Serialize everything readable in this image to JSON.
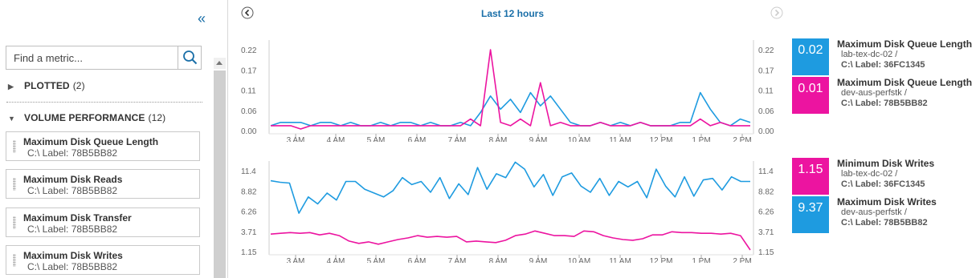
{
  "colors": {
    "blue": "#1e9be0",
    "magenta": "#ec14a0",
    "accent": "#1a6fa8"
  },
  "sidebar": {
    "collapse_icon": "double-chevron-left-icon",
    "search": {
      "placeholder": "Find a metric...",
      "value": ""
    },
    "groups": [
      {
        "label": "PLOTTED",
        "count": "(2)",
        "expanded": false
      },
      {
        "label": "VOLUME PERFORMANCE",
        "count": "(12)",
        "expanded": true
      }
    ],
    "metrics": [
      {
        "name": "Maximum Disk Queue Length",
        "label": "C:\\ Label: 78B5BB82"
      },
      {
        "name": "Maximum Disk Reads",
        "label": "C:\\ Label: 78B5BB82"
      },
      {
        "name": "Maximum Disk Transfer",
        "label": "C:\\ Label: 78B5BB82"
      },
      {
        "name": "Maximum Disk Writes",
        "label": "C:\\ Label: 78B5BB82"
      }
    ]
  },
  "header": {
    "time_range": "Last 12 hours"
  },
  "chart_data": [
    {
      "type": "line",
      "title": "",
      "x": [
        "2:30 AM",
        "2:45 AM",
        "3 AM",
        "3:15 AM",
        "3:30 AM",
        "3:45 AM",
        "4 AM",
        "4:15 AM",
        "4:30 AM",
        "4:45 AM",
        "5 AM",
        "5:15 AM",
        "5:30 AM",
        "5:45 AM",
        "6 AM",
        "6:15 AM",
        "6:30 AM",
        "6:45 AM",
        "7 AM",
        "7:15 AM",
        "7:30 AM",
        "7:45 AM",
        "8 AM",
        "8:15 AM",
        "8:30 AM",
        "8:45 AM",
        "9 AM",
        "9:15 AM",
        "9:30 AM",
        "9:45 AM",
        "10 AM",
        "10:15 AM",
        "10:30 AM",
        "10:45 AM",
        "11 AM",
        "11:15 AM",
        "11:30 AM",
        "11:45 AM",
        "12 PM",
        "12:15 PM",
        "12:30 PM",
        "12:45 PM",
        "1 PM",
        "1:15 PM",
        "1:30 PM",
        "1:45 PM",
        "2 PM",
        "2:15 PM"
      ],
      "xticks": [
        "3 AM",
        "4 AM",
        "5 AM",
        "6 AM",
        "7 AM",
        "8 AM",
        "9 AM",
        "10 AM",
        "11 AM",
        "12 PM",
        "1 PM",
        "2 PM"
      ],
      "yticks": [
        "0.22",
        "0.17",
        "0.11",
        "0.06",
        "0.00"
      ],
      "ylim": [
        0,
        0.24
      ],
      "series": [
        {
          "name": "lab-tex-dc-02",
          "color": "#1e9be0",
          "values": [
            0.01,
            0.02,
            0.02,
            0.02,
            0.01,
            0.02,
            0.02,
            0.01,
            0.02,
            0.01,
            0.01,
            0.02,
            0.01,
            0.02,
            0.02,
            0.01,
            0.02,
            0.01,
            0.01,
            0.02,
            0.01,
            0.05,
            0.1,
            0.06,
            0.09,
            0.05,
            0.11,
            0.07,
            0.1,
            0.06,
            0.02,
            0.01,
            0.01,
            0.02,
            0.01,
            0.02,
            0.01,
            0.02,
            0.01,
            0.01,
            0.01,
            0.02,
            0.02,
            0.11,
            0.06,
            0.02,
            0.01,
            0.03,
            0.02
          ]
        },
        {
          "name": "dev-aus-perfstk",
          "color": "#ec14a0",
          "values": [
            0.01,
            0.01,
            0.01,
            0.0,
            0.01,
            0.01,
            0.01,
            0.01,
            0.01,
            0.01,
            0.01,
            0.01,
            0.01,
            0.01,
            0.01,
            0.01,
            0.01,
            0.01,
            0.01,
            0.01,
            0.03,
            0.01,
            0.24,
            0.02,
            0.01,
            0.03,
            0.01,
            0.14,
            0.01,
            0.02,
            0.01,
            0.01,
            0.01,
            0.02,
            0.01,
            0.01,
            0.01,
            0.02,
            0.01,
            0.01,
            0.01,
            0.01,
            0.01,
            0.03,
            0.01,
            0.02,
            0.01,
            0.01,
            0.01
          ]
        }
      ]
    },
    {
      "type": "line",
      "title": "",
      "x": [
        "2:30 AM",
        "2:45 AM",
        "3 AM",
        "3:15 AM",
        "3:30 AM",
        "3:45 AM",
        "4 AM",
        "4:15 AM",
        "4:30 AM",
        "4:45 AM",
        "5 AM",
        "5:15 AM",
        "5:30 AM",
        "5:45 AM",
        "6 AM",
        "6:15 AM",
        "6:30 AM",
        "6:45 AM",
        "7 AM",
        "7:15 AM",
        "7:30 AM",
        "7:45 AM",
        "8 AM",
        "8:15 AM",
        "8:30 AM",
        "8:45 AM",
        "9 AM",
        "9:15 AM",
        "9:30 AM",
        "9:45 AM",
        "10 AM",
        "10:15 AM",
        "10:30 AM",
        "10:45 AM",
        "11 AM",
        "11:15 AM",
        "11:30 AM",
        "11:45 AM",
        "12 PM",
        "12:15 PM",
        "12:30 PM",
        "12:45 PM",
        "1 PM",
        "1:15 PM",
        "1:30 PM",
        "1:45 PM",
        "2 PM",
        "2:15 PM"
      ],
      "xticks": [
        "3 AM",
        "4 AM",
        "5 AM",
        "6 AM",
        "7 AM",
        "8 AM",
        "9 AM",
        "10 AM",
        "11 AM",
        "12 PM",
        "1 PM",
        "2 PM"
      ],
      "yticks": [
        "11.4",
        "8.82",
        "6.26",
        "3.71",
        "1.15"
      ],
      "ylim": [
        1.15,
        11.4
      ],
      "series": [
        {
          "name": "lab-tex-dc-02",
          "color": "#1e9be0",
          "values": [
            10.1,
            9.9,
            9.8,
            5.9,
            8.0,
            7.1,
            8.5,
            7.6,
            10.0,
            10.0,
            9.0,
            8.5,
            8.0,
            8.8,
            10.5,
            9.6,
            10.0,
            8.6,
            10.5,
            7.8,
            9.7,
            8.3,
            11.8,
            9.0,
            11.0,
            10.5,
            12.5,
            11.6,
            9.3,
            10.9,
            8.2,
            10.6,
            11.1,
            9.4,
            8.6,
            10.4,
            8.2,
            10.0,
            9.3,
            10.0,
            7.9,
            11.6,
            9.4,
            8.0,
            10.6,
            8.1,
            10.2,
            10.4,
            8.9,
            10.6,
            10.0,
            10.0
          ]
        },
        {
          "name": "dev-aus-perfstk",
          "color": "#ec14a0",
          "values": [
            3.2,
            3.3,
            3.4,
            3.3,
            3.4,
            3.1,
            3.3,
            3.0,
            2.3,
            2.0,
            2.2,
            1.9,
            2.2,
            2.5,
            2.7,
            3.0,
            2.8,
            2.9,
            2.8,
            2.9,
            2.2,
            2.3,
            2.2,
            2.1,
            2.4,
            3.0,
            3.2,
            3.6,
            3.3,
            3.0,
            3.0,
            2.9,
            3.6,
            3.5,
            3.0,
            2.7,
            2.5,
            2.4,
            2.6,
            3.1,
            3.1,
            3.5,
            3.4,
            3.4,
            3.3,
            3.3,
            3.2,
            3.3,
            3.0,
            1.15
          ]
        }
      ]
    }
  ],
  "legends": [
    {
      "value": "0.02",
      "color": "#1e9be0",
      "title": "Maximum Disk Queue Length",
      "node": "lab-tex-dc-02 /",
      "label": "C:\\ Label: 36FC1345"
    },
    {
      "value": "0.01",
      "color": "#ec14a0",
      "title": "Maximum Disk Queue Length",
      "node": "dev-aus-perfstk /",
      "label": "C:\\ Label: 78B5BB82"
    },
    {
      "value": "1.15",
      "color": "#ec14a0",
      "title": "Minimum Disk Writes",
      "node": "lab-tex-dc-02 /",
      "label": "C:\\ Label: 36FC1345"
    },
    {
      "value": "9.37",
      "color": "#1e9be0",
      "title": "Maximum Disk Writes",
      "node": "dev-aus-perfstk /",
      "label": "C:\\ Label: 78B5BB82"
    }
  ]
}
